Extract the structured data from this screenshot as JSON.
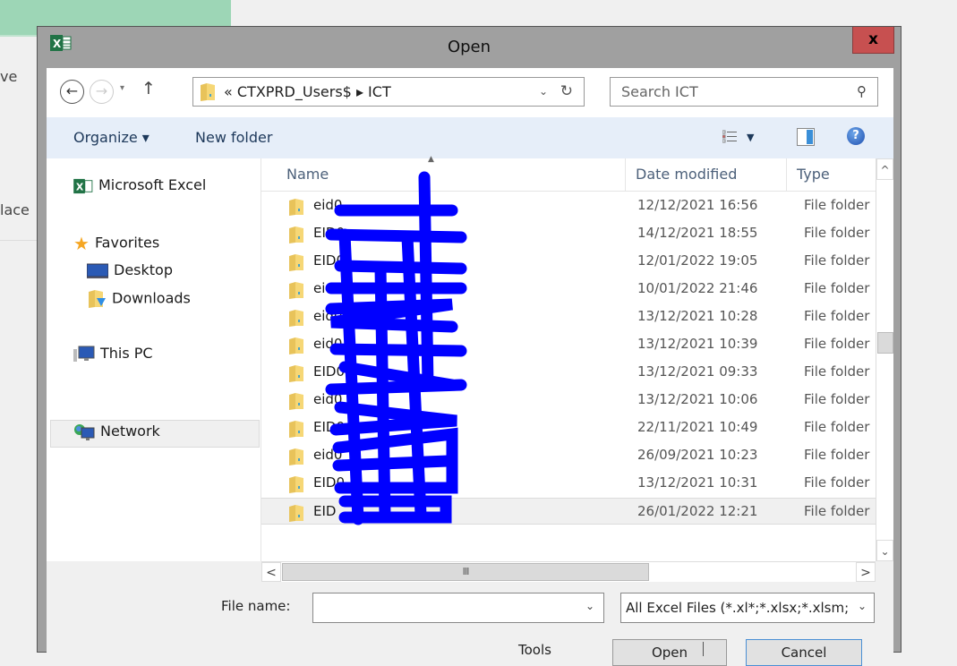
{
  "background": {
    "fragment_1": "ve",
    "fragment_2": "lace"
  },
  "dialog": {
    "title": "Open",
    "close_label": "x"
  },
  "navigation": {
    "back_icon": "arrow-left-circle",
    "forward_icon": "arrow-right-circle",
    "recent_dropdown_icon": "▾",
    "up_icon": "↑",
    "address_path": "«  CTXPRD_Users$  ▸  ICT",
    "address_dropdown": "⌄",
    "refresh_icon": "↻",
    "search_placeholder": "Search ICT",
    "search_icon": "⚲"
  },
  "toolbar": {
    "organize_label": "Organize ▾",
    "new_folder_label": "New folder",
    "help_label": "?"
  },
  "sidebar": {
    "items": [
      {
        "label": "Microsoft Excel",
        "icon": "excel-icon"
      },
      {
        "label": "Favorites",
        "icon": "star-icon"
      },
      {
        "label": "Desktop",
        "icon": "desktop-icon"
      },
      {
        "label": "Downloads",
        "icon": "downloads-icon"
      },
      {
        "label": "This PC",
        "icon": "computer-icon"
      },
      {
        "label": "Network",
        "icon": "network-icon",
        "selected": true
      }
    ]
  },
  "file_list": {
    "columns": [
      "Name",
      "Date modified",
      "Type"
    ],
    "rows": [
      {
        "name": "eid0",
        "date": "12/12/2021 16:56",
        "type": "File folder"
      },
      {
        "name": "EID0",
        "date": "14/12/2021 18:55",
        "type": "File folder"
      },
      {
        "name": "EID0",
        "date": "12/01/2022 19:05",
        "type": "File folder"
      },
      {
        "name": "eid0",
        "date": "10/01/2022 21:46",
        "type": "File folder"
      },
      {
        "name": "eid0",
        "date": "13/12/2021 10:28",
        "type": "File folder"
      },
      {
        "name": "eid0",
        "date": "13/12/2021 10:39",
        "type": "File folder"
      },
      {
        "name": "EID0",
        "date": "13/12/2021 09:33",
        "type": "File folder"
      },
      {
        "name": "eid0",
        "date": "13/12/2021 10:06",
        "type": "File folder"
      },
      {
        "name": "EID0",
        "date": "22/11/2021 10:49",
        "type": "File folder"
      },
      {
        "name": "eid0",
        "date": "26/09/2021 10:23",
        "type": "File folder"
      },
      {
        "name": "EID0",
        "date": "13/12/2021 10:31",
        "type": "File folder"
      },
      {
        "name": "EID",
        "date": "26/01/2022 12:21",
        "type": "File folder",
        "selected": true
      }
    ],
    "names_redacted": true
  },
  "scrollbars": {
    "up": "^",
    "down": "⌄",
    "left": "<",
    "right": ">",
    "grip": "III"
  },
  "footer": {
    "file_name_label": "File name:",
    "file_name_value": "",
    "file_type_value": "All Excel Files (*.xl*;*.xlsx;*.xlsm;",
    "dropdown_glyph": "⌄",
    "tools_label": "Tools",
    "open_label": "Open",
    "cancel_label": "Cancel"
  },
  "colors": {
    "close_button": "#c75050",
    "toolbar_bg": "#e6eef9",
    "redaction": "#0000ff",
    "excel_green": "#217346"
  }
}
